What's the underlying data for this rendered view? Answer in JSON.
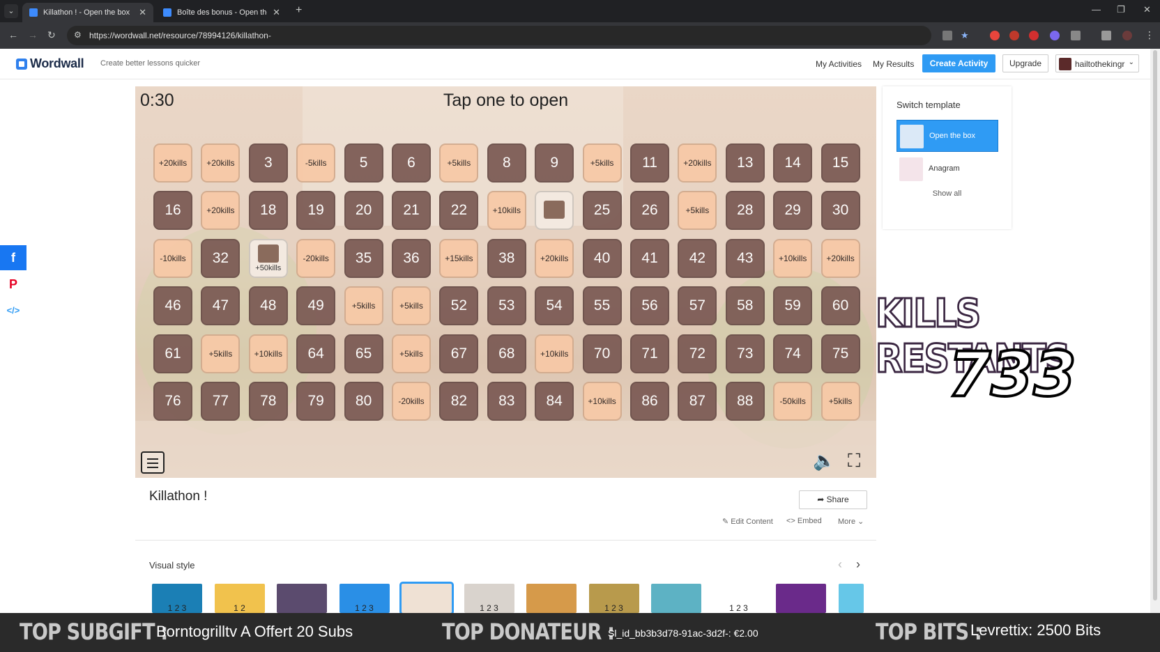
{
  "browser": {
    "tabs": [
      {
        "title": "Killathon ! - Open the box",
        "active": true
      },
      {
        "title": "Boîte des bonus - Open the bo",
        "active": false
      }
    ],
    "url": "https://wordwall.net/resource/78994126/killathon-"
  },
  "header": {
    "logo": "Wordwall",
    "tagline": "Create better lessons quicker",
    "links": [
      "My Activities",
      "My Results"
    ],
    "create_label": "Create Activity",
    "upgrade_label": "Upgrade",
    "username": "hailtothekingr"
  },
  "game": {
    "timer": "0:30",
    "instruction": "Tap one to open",
    "boxes": [
      {
        "label": "+20kills",
        "kind": "bonus"
      },
      {
        "label": "+20kills",
        "kind": "bonus"
      },
      {
        "label": "3",
        "kind": "num"
      },
      {
        "label": "-5kills",
        "kind": "bonus"
      },
      {
        "label": "5",
        "kind": "num"
      },
      {
        "label": "6",
        "kind": "num"
      },
      {
        "label": "+5kills",
        "kind": "bonus"
      },
      {
        "label": "8",
        "kind": "num"
      },
      {
        "label": "9",
        "kind": "num"
      },
      {
        "label": "+5kills",
        "kind": "bonus"
      },
      {
        "label": "11",
        "kind": "num"
      },
      {
        "label": "+20kills",
        "kind": "bonus"
      },
      {
        "label": "13",
        "kind": "num"
      },
      {
        "label": "14",
        "kind": "num"
      },
      {
        "label": "15",
        "kind": "num"
      },
      {
        "label": "16",
        "kind": "num"
      },
      {
        "label": "+20kills",
        "kind": "bonus"
      },
      {
        "label": "18",
        "kind": "num"
      },
      {
        "label": "19",
        "kind": "num"
      },
      {
        "label": "20",
        "kind": "num"
      },
      {
        "label": "21",
        "kind": "num"
      },
      {
        "label": "22",
        "kind": "num"
      },
      {
        "label": "+10kills",
        "kind": "bonus"
      },
      {
        "label": "",
        "kind": "img"
      },
      {
        "label": "25",
        "kind": "num"
      },
      {
        "label": "26",
        "kind": "num"
      },
      {
        "label": "+5kills",
        "kind": "bonus"
      },
      {
        "label": "28",
        "kind": "num"
      },
      {
        "label": "29",
        "kind": "num"
      },
      {
        "label": "30",
        "kind": "num"
      },
      {
        "label": "-10kills",
        "kind": "bonus"
      },
      {
        "label": "32",
        "kind": "num"
      },
      {
        "label": "+50kills",
        "kind": "img"
      },
      {
        "label": "-20kills",
        "kind": "bonus"
      },
      {
        "label": "35",
        "kind": "num"
      },
      {
        "label": "36",
        "kind": "num"
      },
      {
        "label": "+15kills",
        "kind": "bonus"
      },
      {
        "label": "38",
        "kind": "num"
      },
      {
        "label": "+20kills",
        "kind": "bonus"
      },
      {
        "label": "40",
        "kind": "num"
      },
      {
        "label": "41",
        "kind": "num"
      },
      {
        "label": "42",
        "kind": "num"
      },
      {
        "label": "43",
        "kind": "num"
      },
      {
        "label": "+10kills",
        "kind": "bonus"
      },
      {
        "label": "+20kills",
        "kind": "bonus"
      },
      {
        "label": "46",
        "kind": "num"
      },
      {
        "label": "47",
        "kind": "num"
      },
      {
        "label": "48",
        "kind": "num"
      },
      {
        "label": "49",
        "kind": "num"
      },
      {
        "label": "+5kills",
        "kind": "bonus"
      },
      {
        "label": "+5kills",
        "kind": "bonus"
      },
      {
        "label": "52",
        "kind": "num"
      },
      {
        "label": "53",
        "kind": "num"
      },
      {
        "label": "54",
        "kind": "num"
      },
      {
        "label": "55",
        "kind": "num"
      },
      {
        "label": "56",
        "kind": "num"
      },
      {
        "label": "57",
        "kind": "num"
      },
      {
        "label": "58",
        "kind": "num"
      },
      {
        "label": "59",
        "kind": "num"
      },
      {
        "label": "60",
        "kind": "num"
      },
      {
        "label": "61",
        "kind": "num"
      },
      {
        "label": "+5kills",
        "kind": "bonus"
      },
      {
        "label": "+10kills",
        "kind": "bonus"
      },
      {
        "label": "64",
        "kind": "num"
      },
      {
        "label": "65",
        "kind": "num"
      },
      {
        "label": "+5kills",
        "kind": "bonus"
      },
      {
        "label": "67",
        "kind": "num"
      },
      {
        "label": "68",
        "kind": "num"
      },
      {
        "label": "+10kills",
        "kind": "bonus"
      },
      {
        "label": "70",
        "kind": "num"
      },
      {
        "label": "71",
        "kind": "num"
      },
      {
        "label": "72",
        "kind": "num"
      },
      {
        "label": "73",
        "kind": "num"
      },
      {
        "label": "74",
        "kind": "num"
      },
      {
        "label": "75",
        "kind": "num"
      },
      {
        "label": "76",
        "kind": "num"
      },
      {
        "label": "77",
        "kind": "num"
      },
      {
        "label": "78",
        "kind": "num"
      },
      {
        "label": "79",
        "kind": "num"
      },
      {
        "label": "80",
        "kind": "num"
      },
      {
        "label": "-20kills",
        "kind": "bonus"
      },
      {
        "label": "82",
        "kind": "num"
      },
      {
        "label": "83",
        "kind": "num"
      },
      {
        "label": "84",
        "kind": "num"
      },
      {
        "label": "+10kills",
        "kind": "bonus"
      },
      {
        "label": "86",
        "kind": "num"
      },
      {
        "label": "87",
        "kind": "num"
      },
      {
        "label": "88",
        "kind": "num"
      },
      {
        "label": "-50kills",
        "kind": "bonus"
      },
      {
        "label": "+5kills",
        "kind": "bonus"
      }
    ]
  },
  "panel": {
    "title": "Switch template",
    "templates": [
      {
        "label": "Open the box",
        "active": true
      },
      {
        "label": "Anagram",
        "active": false
      }
    ],
    "show_all": "Show all"
  },
  "overlay": {
    "title": "KILLS RESTANTS",
    "count": "733"
  },
  "activity": {
    "title": "Killathon !",
    "share_label": "Share",
    "edit_label": "Edit Content",
    "embed_label": "Embed",
    "more_label": "More"
  },
  "visual_style": {
    "title": "Visual style",
    "thumbs": [
      {
        "text": "1 2 3",
        "bg": "#1b7fb5"
      },
      {
        "text": "1 2",
        "bg": "#f1c24d"
      },
      {
        "text": "",
        "bg": "#5b4b6e"
      },
      {
        "text": "1 2 3",
        "bg": "#2a8fe6"
      },
      {
        "text": "",
        "bg": "#efe1d4"
      },
      {
        "text": "1 2 3",
        "bg": "#d9d3cd"
      },
      {
        "text": "",
        "bg": "#d69a4a"
      },
      {
        "text": "1 2 3",
        "bg": "#b89a4c"
      },
      {
        "text": "",
        "bg": "#5db2c4"
      },
      {
        "text": "1 2 3",
        "bg": "#ffffff"
      },
      {
        "text": "",
        "bg": "#6a2a8a"
      },
      {
        "text": "",
        "bg": "#66c7e8"
      }
    ]
  },
  "stream": {
    "subgift_label": "TOP SUBGIFT :",
    "subgift_value": "Borntogrilltv A Offert 20 Subs",
    "donor_label": "TOP DONATEUR :",
    "donor_value": "Sl_id_bb3b3d78-91ac-3d2f-: €2.00",
    "bits_label": "TOP BITS :",
    "bits_value": "Levrettix: 2500 Bits"
  }
}
